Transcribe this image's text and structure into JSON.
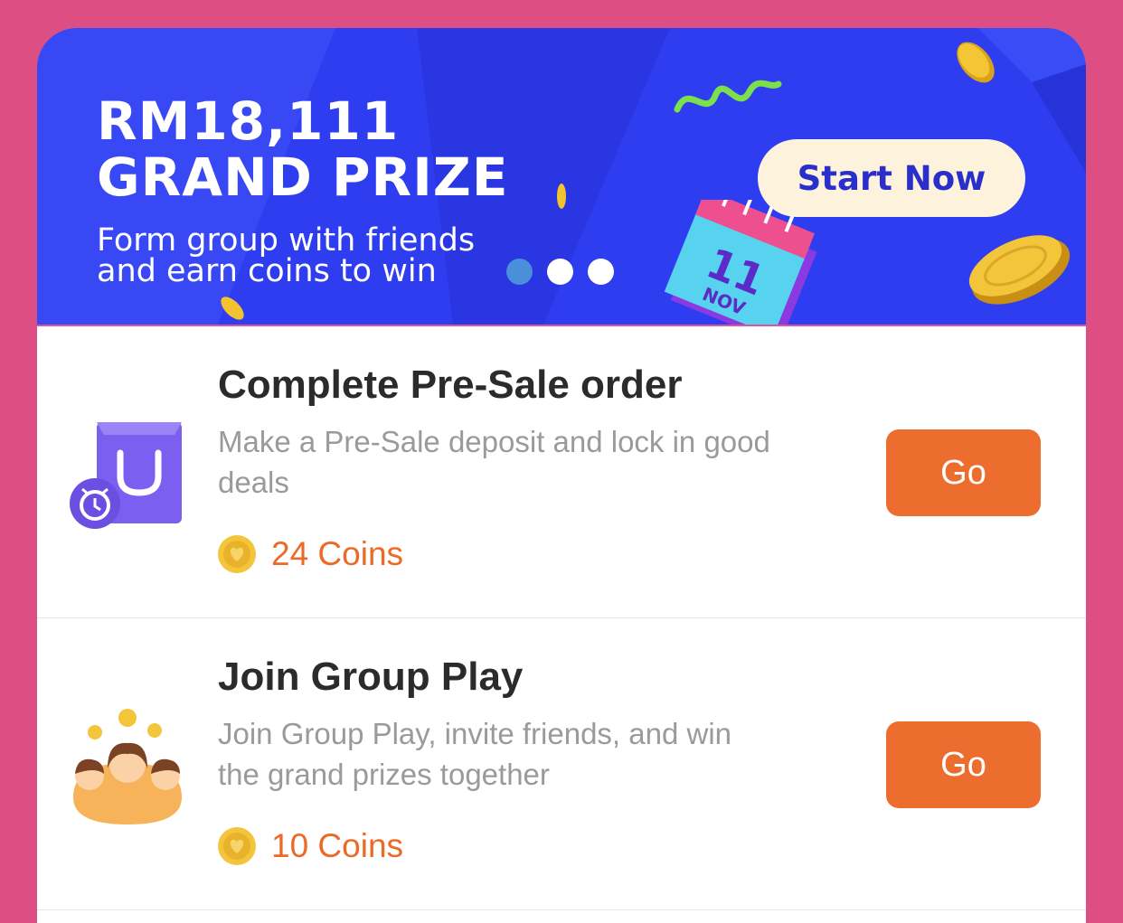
{
  "banner": {
    "headline_line1": "RM18,111",
    "headline_line2": "GRAND PRIZE",
    "subline_line1": "Form group with friends",
    "subline_line2": "and earn coins to win",
    "cta_label": "Start Now",
    "calendar_day": "11",
    "calendar_month": "NOV",
    "carousel": {
      "slide_count": 3,
      "active_index": 0
    }
  },
  "tasks": [
    {
      "title": "Complete Pre-Sale order",
      "description": "Make a Pre-Sale deposit and lock in good deals",
      "reward": "24 Coins",
      "button_label": "Go",
      "icon": "shopping-bag-alarm-icon"
    },
    {
      "title": "Join Group Play",
      "description": "Join Group Play, invite friends, and win the grand prizes together",
      "reward": "10 Coins",
      "button_label": "Go",
      "icon": "group-people-icon"
    }
  ],
  "colors": {
    "page_background": "#dd4f83",
    "banner_background": "#2f3df0",
    "accent_orange": "#ec6d2d",
    "coin_gold": "#f2c230"
  }
}
